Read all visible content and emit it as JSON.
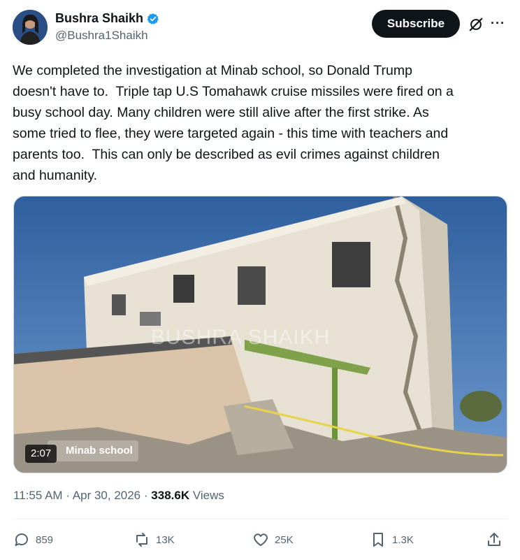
{
  "author": {
    "display_name": "Bushra Shaikh",
    "handle": "@Bushra1Shaikh",
    "verified": true,
    "verified_color": "#1d9bf0"
  },
  "header": {
    "subscribe_label": "Subscribe",
    "grok_icon": "grok-slash-icon",
    "more_icon": "more-horizontal-icon",
    "more_label": "···"
  },
  "tweet": {
    "text": "We completed the investigation at Minab school, so Donald Trump\ndoesn't have to.  Triple tap U.S Tomahawk cruise missiles were fired on a\nbusy school day. Many children were still alive after the first strike. As\nsome tried to flee, they were targeted again - this time with teachers and\nparents too.  This can only be described as evil crimes against children\nand humanity."
  },
  "media": {
    "watermark": "BUSHRA SHAIKH",
    "duration": "2:07",
    "location_label": "Minab school"
  },
  "meta": {
    "time": "11:55 AM",
    "separator": "·",
    "date": "Apr 30, 2026",
    "views_count": "338.6K",
    "views_label": "Views"
  },
  "actions": {
    "replies": "859",
    "reposts": "13K",
    "likes": "25K",
    "bookmarks": "1.3K"
  },
  "colors": {
    "text_primary": "#0f1419",
    "text_secondary": "#536471",
    "button_dark": "#0f1419"
  }
}
